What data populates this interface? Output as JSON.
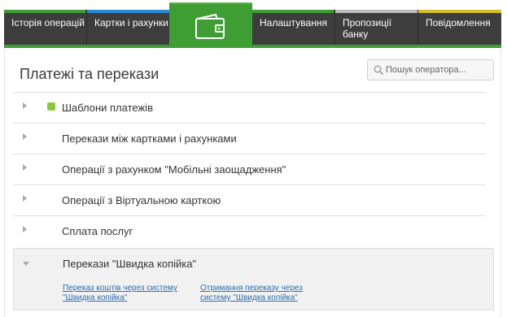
{
  "nav": {
    "tabs": [
      {
        "label": "Історія операцій",
        "accent": "#3f9e33"
      },
      {
        "label": "Картки і рахунки",
        "accent": "#2a8ad2"
      },
      {
        "label": "Налаштування",
        "accent": "#3f9e33"
      },
      {
        "label": "Пропозиції банку",
        "accent": "#bcbcbc"
      },
      {
        "label": "Повідомлення",
        "accent": "#d4bf2c"
      }
    ],
    "active_icon": "wallet-icon",
    "active_color": "#3f9e33"
  },
  "page": {
    "title": "Платежі та перекази"
  },
  "search": {
    "placeholder": "Пошук оператора..."
  },
  "sections": [
    {
      "label": "Шаблони платежів",
      "marker": "green-square"
    },
    {
      "label": "Перекази між картками і рахунками"
    },
    {
      "label": "Операції з рахунком \"Мобільні заощадження\""
    },
    {
      "label": "Операції з Віртуальною карткою"
    },
    {
      "label": "Сплата послуг"
    }
  ],
  "expanded_section": {
    "label": "Перекази \"Швидка копійка\"",
    "links": [
      {
        "line1": "Переказ коштів через систему",
        "line2": "\"Швидка копійка\""
      },
      {
        "line1": "Отримання переказу через",
        "line2": "систему \"Швидка копійка\""
      }
    ]
  },
  "colors": {
    "nav_bg": "#3d3d3d",
    "green": "#3f9e33",
    "link": "#2a6db2",
    "template_marker": "#8cc63f"
  }
}
